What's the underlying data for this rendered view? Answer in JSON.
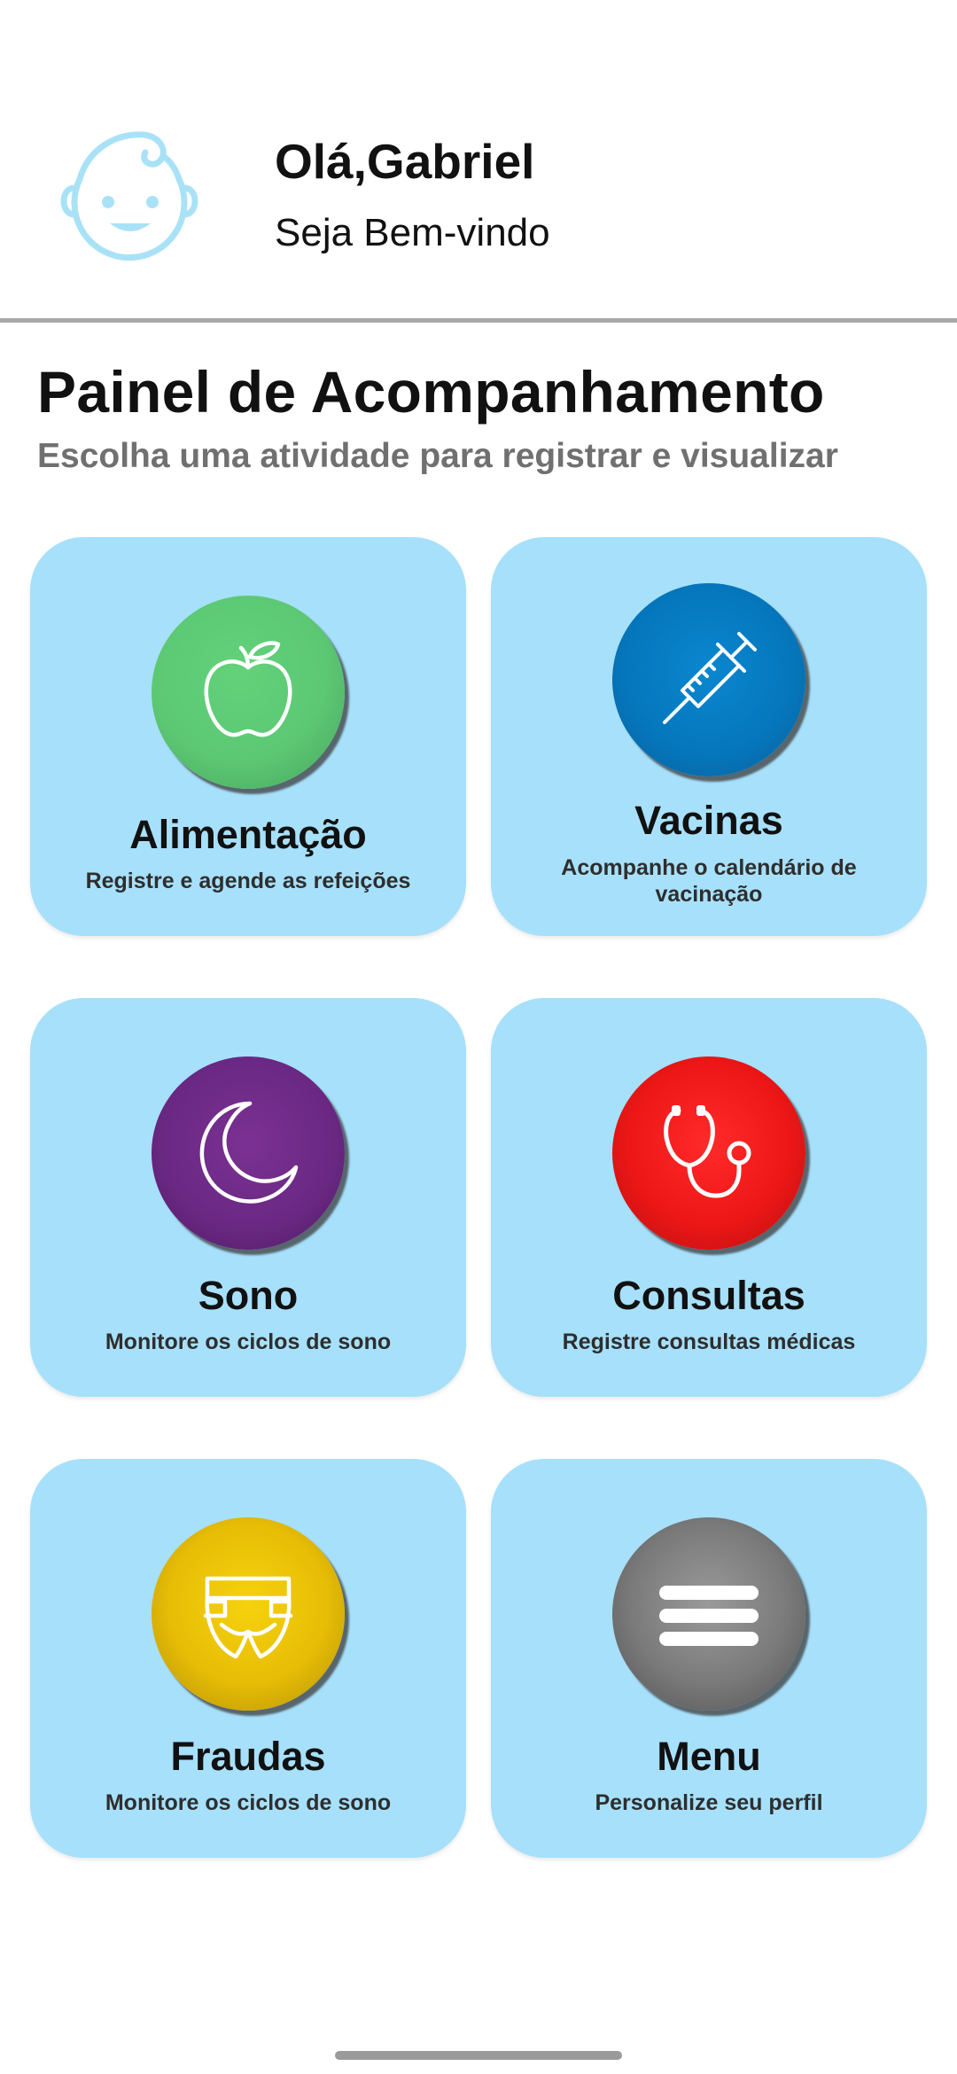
{
  "header": {
    "greeting": "Olá,Gabriel",
    "welcome": "Seja Bem-vindo",
    "avatar_icon": "baby-face-icon"
  },
  "dashboard": {
    "title": "Painel de Acompanhamento",
    "subtitle": "Escolha uma atividade para registrar e visualizar"
  },
  "cards": [
    {
      "title": "Alimentação",
      "desc": "Registre e agende as refeições",
      "icon": "apple-icon",
      "color": "#5cc874"
    },
    {
      "title": "Vacinas",
      "desc": "Acompanhe o calendário de vacinação",
      "icon": "syringe-icon",
      "color": "#0576bb"
    },
    {
      "title": "Sono",
      "desc": "Monitore os ciclos de sono",
      "icon": "moon-icon",
      "color": "#6a2883"
    },
    {
      "title": "Consultas",
      "desc": "Registre consultas médicas",
      "icon": "stethoscope-icon",
      "color": "#ee1717"
    },
    {
      "title": "Fraudas",
      "desc": "Monitore os ciclos de sono",
      "icon": "diaper-icon",
      "color": "#e7bd06"
    },
    {
      "title": "Menu",
      "desc": "Personalize seu perfil",
      "icon": "hamburger-menu-icon",
      "color": "#7a7a7a"
    }
  ],
  "colors": {
    "card_background": "#a7e0fb",
    "avatar_outline": "#a9e2f7",
    "subtitle_gray": "#707070"
  }
}
